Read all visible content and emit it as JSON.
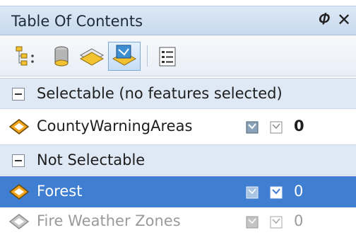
{
  "panel": {
    "title": "Table Of Contents",
    "pin_icon": "pin-icon",
    "close_icon": "close-icon"
  },
  "toolbar": {
    "buttons": [
      {
        "name": "list-by-drawing-order",
        "icon": "layers-tree-icon"
      },
      {
        "name": "list-by-source",
        "icon": "database-icon"
      },
      {
        "name": "list-by-visibility",
        "icon": "layers-stack-icon"
      },
      {
        "name": "list-by-selection",
        "icon": "selection-layer-icon",
        "active": true
      },
      {
        "name": "options",
        "icon": "options-list-icon"
      }
    ]
  },
  "groups": [
    {
      "label": "Selectable (no features selected)",
      "expanded": true,
      "layers": [
        {
          "name": "CountyWarningAreas",
          "count": "0",
          "state": "normal"
        }
      ]
    },
    {
      "label": "Not Selectable",
      "expanded": true,
      "layers": [
        {
          "name": "Forest",
          "count": "0",
          "state": "selected"
        },
        {
          "name": "Fire Weather Zones",
          "count": "0",
          "state": "disabled"
        }
      ]
    }
  ],
  "colors": {
    "selection": "#3f7ed0",
    "group_header": "#dfe9f5",
    "disabled_text": "#9a9a9a"
  }
}
